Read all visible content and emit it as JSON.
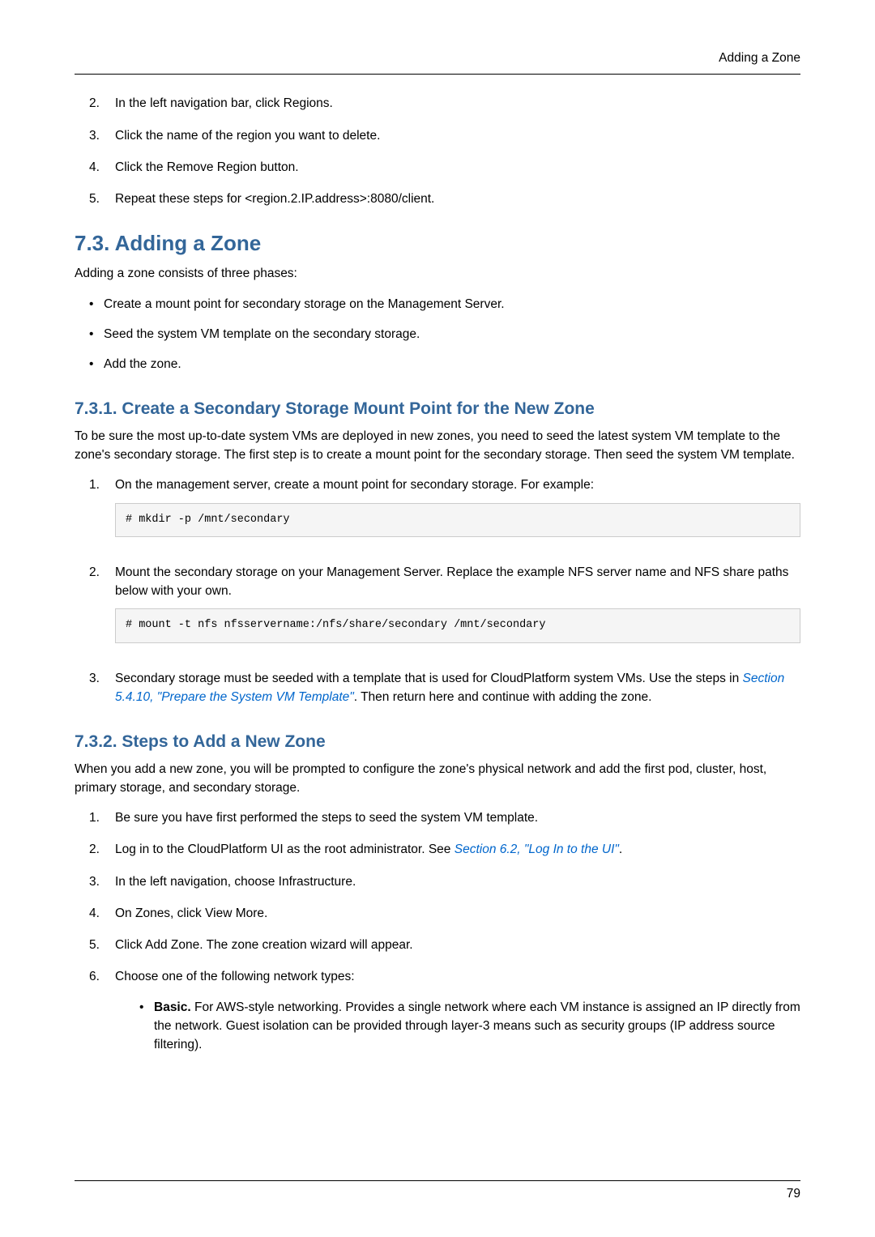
{
  "header": {
    "title": "Adding a Zone"
  },
  "list_7_2": {
    "items": [
      {
        "num": "2.",
        "text": "In the left navigation bar, click Regions."
      },
      {
        "num": "3.",
        "text": "Click the name of the region you want to delete."
      },
      {
        "num": "4.",
        "text": "Click the Remove Region button."
      },
      {
        "num": "5.",
        "text": "Repeat these steps for <region.2.IP.address>:8080/client."
      }
    ]
  },
  "section_7_3": {
    "heading": "7.3. Adding a Zone",
    "intro": "Adding a zone consists of three phases:",
    "bullets": [
      "Create a mount point for secondary storage on the Management Server.",
      "Seed the system VM template on the secondary storage.",
      "Add the zone."
    ]
  },
  "section_7_3_1": {
    "heading": "7.3.1. Create a Secondary Storage Mount Point for the New Zone",
    "intro": "To be sure the most up-to-date system VMs are deployed in new zones, you need to seed the latest system VM template to the zone's secondary storage. The first step is to create a mount point for the secondary storage. Then seed the system VM template.",
    "step1": {
      "num": "1.",
      "text": "On the management server, create a mount point for secondary storage. For example:",
      "code": "# mkdir -p /mnt/secondary"
    },
    "step2": {
      "num": "2.",
      "text": "Mount the secondary storage on your Management Server. Replace the example NFS server name and NFS share paths below with your own.",
      "code": "# mount -t nfs nfsservername:/nfs/share/secondary /mnt/secondary"
    },
    "step3": {
      "num": "3.",
      "text_before": "Secondary storage must be seeded with a template that is used for CloudPlatform system VMs. Use the steps in ",
      "link": "Section 5.4.10, \"Prepare the System VM Template\"",
      "text_after": ". Then return here and continue with adding the zone."
    }
  },
  "section_7_3_2": {
    "heading": "7.3.2. Steps to Add a New Zone",
    "intro": "When you add a new zone, you will be prompted to configure the zone's physical network and add the first pod, cluster, host, primary storage, and secondary storage.",
    "items": [
      {
        "num": "1.",
        "text": "Be sure you have first performed the steps to seed the system VM template."
      },
      {
        "num": "2.",
        "text_before": "Log in to the CloudPlatform UI as the root administrator. See ",
        "link": "Section 6.2, \"Log In to the UI\"",
        "text_after": "."
      },
      {
        "num": "3.",
        "text": "In the left navigation, choose Infrastructure."
      },
      {
        "num": "4.",
        "text": "On Zones, click View More."
      },
      {
        "num": "5.",
        "text": "Click Add Zone. The zone creation wizard will appear."
      },
      {
        "num": "6.",
        "text": "Choose one of the following network types:"
      }
    ],
    "nested": {
      "bold": "Basic.",
      "rest": " For AWS-style networking. Provides a single network where each VM instance is assigned an IP directly from the network. Guest isolation can be provided through layer-3 means such as security groups (IP address source filtering)."
    }
  },
  "footer": {
    "page": "79"
  }
}
